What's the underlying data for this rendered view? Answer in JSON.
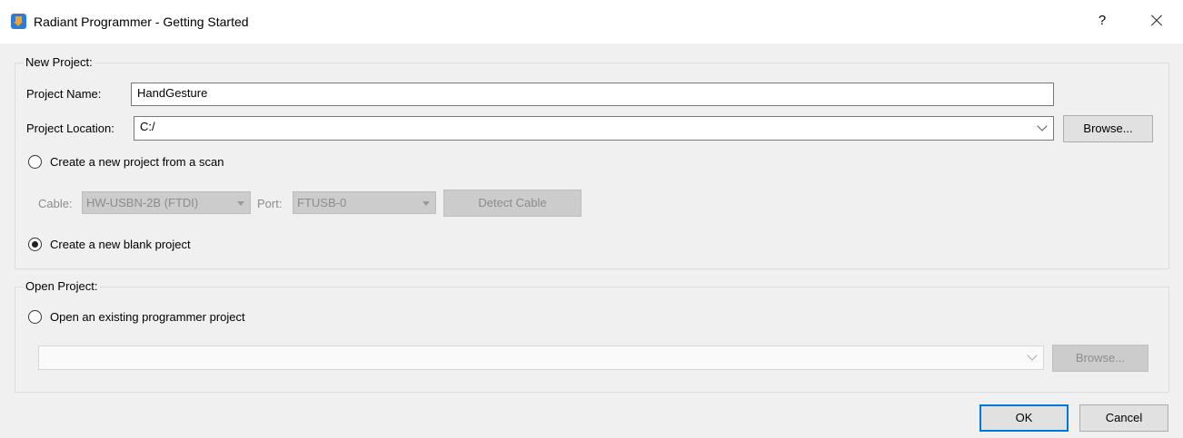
{
  "window": {
    "title": "Radiant Programmer - Getting Started",
    "help_label": "?"
  },
  "new_project": {
    "group_title": "New Project:",
    "name_label": "Project Name:",
    "name_value": "HandGesture",
    "location_label": "Project Location:",
    "location_value": "C:/",
    "browse_label": "Browse...",
    "scan_option_label": "Create a new project from a scan",
    "scan_option_selected": false,
    "cable_label": "Cable:",
    "cable_value": "HW-USBN-2B (FTDI)",
    "port_label": "Port:",
    "port_value": "FTUSB-0",
    "detect_cable_label": "Detect Cable",
    "blank_option_label": "Create a new blank project",
    "blank_option_selected": true
  },
  "open_project": {
    "group_title": "Open Project:",
    "existing_option_label": "Open an existing programmer project",
    "existing_option_selected": false,
    "path_value": "",
    "browse_label": "Browse..."
  },
  "footer": {
    "ok_label": "OK",
    "cancel_label": "Cancel"
  },
  "colors": {
    "dialog_background": "#f0f0f0",
    "default_button_border": "#0078d7",
    "disabled_text": "#8c8c8c"
  },
  "icons": {
    "app": "radiant-programmer-icon",
    "close": "close-icon",
    "dropdown": "chevron-down-icon"
  }
}
